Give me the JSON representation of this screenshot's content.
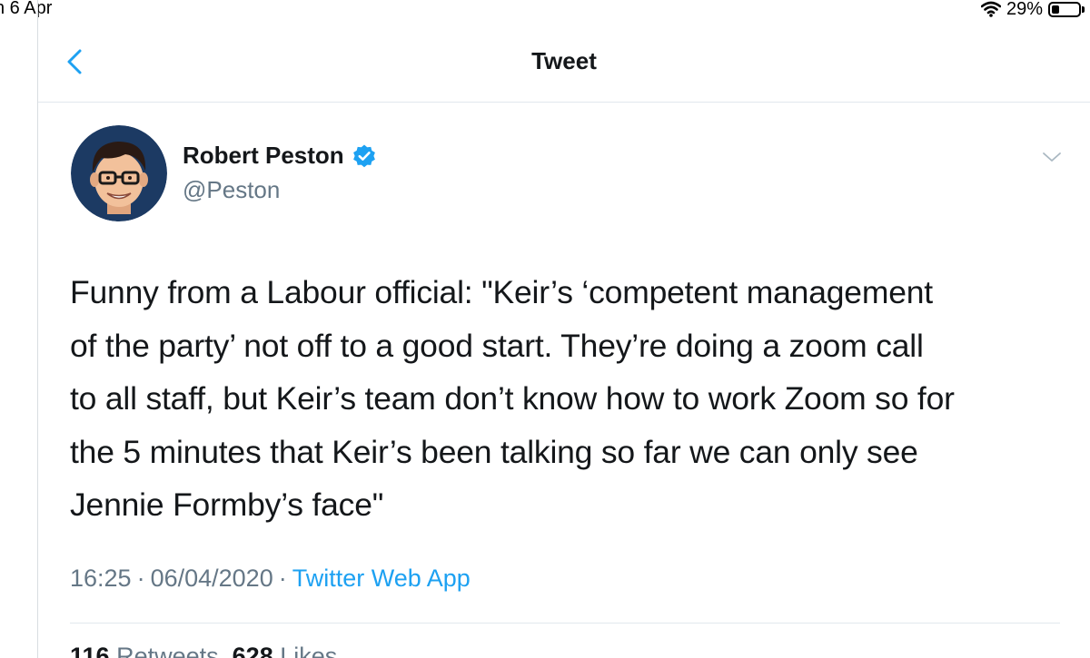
{
  "status_bar": {
    "date": "n 6 Apr",
    "battery_percent": "29%",
    "battery_level": 0.29,
    "wifi_icon": "wifi-icon"
  },
  "header": {
    "title": "Tweet",
    "back_icon": "chevron-left-icon"
  },
  "tweet": {
    "author_name": "Robert Peston",
    "author_handle": "@Peston",
    "verified": true,
    "text": "Funny from a Labour official: \"Keir’s ‘competent management\nof the party’ not off to a good start. They’re doing a zoom call\nto all staff, but Keir’s team don’t know how to work Zoom so for\nthe 5 minutes that Keir’s been talking so far we can only see\nJennie Formby’s face\"",
    "time": "16:25",
    "separator": "·",
    "date": "06/04/2020",
    "source": "Twitter Web App",
    "retweets_count": "116",
    "retweets_label": "Retweets",
    "likes_count": "628",
    "likes_label": "Likes"
  },
  "colors": {
    "accent": "#1da1f2",
    "secondary_text": "#657786",
    "divider": "#e1e8ed"
  }
}
